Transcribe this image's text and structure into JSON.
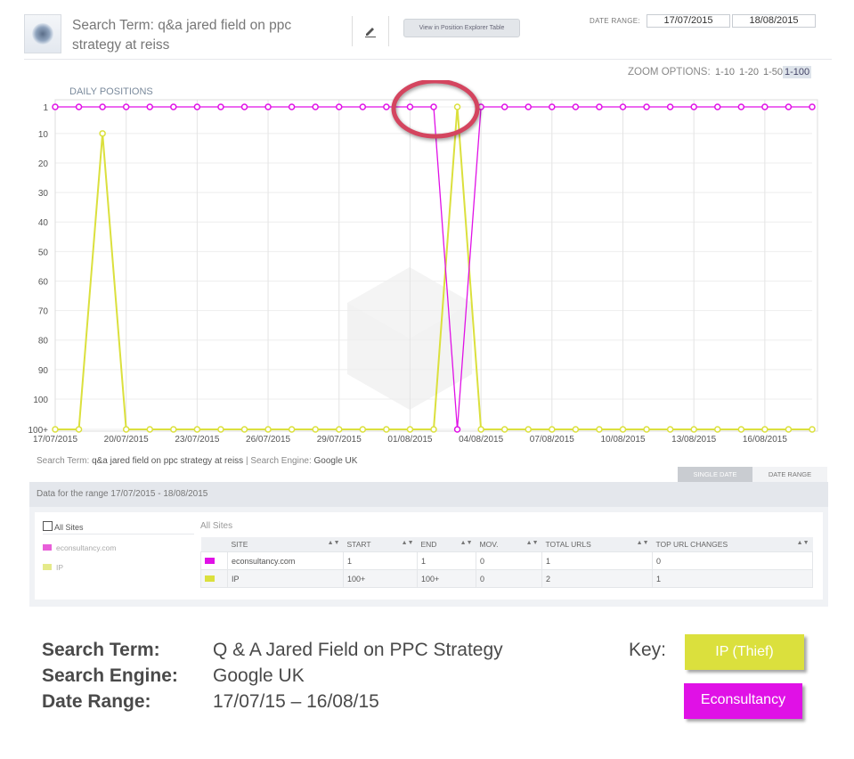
{
  "header": {
    "search_term_label": "Search Term: q&a jared field on ppc strategy at reiss",
    "view_button": "View in Position Explorer Table",
    "date_range_label": "DATE RANGE:",
    "date_from": "17/07/2015",
    "date_to": "18/08/2015",
    "thumbnail_icon": "brand-logo-icon",
    "edit_icon": "pencil-icon"
  },
  "zoom": {
    "label": "ZOOM OPTIONS:",
    "options": [
      "1-10",
      "1-20",
      "1-50",
      "1-100"
    ],
    "selected": "1-100"
  },
  "chart_data": {
    "type": "line",
    "title": "DAILY POSITIONS",
    "ylabel": "",
    "xlabel": "",
    "y_ticks": [
      "1",
      "10",
      "20",
      "30",
      "40",
      "50",
      "60",
      "70",
      "80",
      "90",
      "100",
      "100+"
    ],
    "y_tick_values": [
      1,
      10,
      20,
      30,
      40,
      50,
      60,
      70,
      80,
      90,
      100,
      101
    ],
    "y_inverted": true,
    "ylim": [
      1,
      101
    ],
    "x_tick_labels": [
      "17/07/2015",
      "20/07/2015",
      "23/07/2015",
      "26/07/2015",
      "29/07/2015",
      "01/08/2015",
      "04/08/2015",
      "07/08/2015",
      "10/08/2015",
      "13/08/2015",
      "16/08/2015"
    ],
    "x": [
      "17/07/2015",
      "18/07/2015",
      "19/07/2015",
      "20/07/2015",
      "21/07/2015",
      "22/07/2015",
      "23/07/2015",
      "24/07/2015",
      "25/07/2015",
      "26/07/2015",
      "27/07/2015",
      "28/07/2015",
      "29/07/2015",
      "30/07/2015",
      "31/07/2015",
      "01/08/2015",
      "02/08/2015",
      "03/08/2015",
      "04/08/2015",
      "05/08/2015",
      "06/08/2015",
      "07/08/2015",
      "08/08/2015",
      "09/08/2015",
      "10/08/2015",
      "11/08/2015",
      "12/08/2015",
      "13/08/2015",
      "14/08/2015",
      "15/08/2015",
      "16/08/2015",
      "17/08/2015",
      "18/08/2015"
    ],
    "series": [
      {
        "name": "econsultancy.com",
        "color": "#e011e6",
        "values": [
          1,
          1,
          1,
          1,
          1,
          1,
          1,
          1,
          1,
          1,
          1,
          1,
          1,
          1,
          1,
          1,
          1,
          "100+",
          1,
          1,
          1,
          1,
          1,
          1,
          1,
          1,
          1,
          1,
          1,
          1,
          1,
          1,
          1,
          1
        ]
      },
      {
        "name": "IP",
        "color": "#dbe03d",
        "values": [
          "100+",
          "100+",
          10,
          "100+",
          "100+",
          "100+",
          "100+",
          "100+",
          "100+",
          "100+",
          "100+",
          "100+",
          "100+",
          "100+",
          "100+",
          "100+",
          "100+",
          1,
          "100+",
          "100+",
          "100+",
          "100+",
          "100+",
          "100+",
          "100+",
          "100+",
          "100+",
          "100+",
          "100+",
          "100+",
          "100+",
          "100+",
          "100+",
          "100+"
        ]
      }
    ],
    "grid": true,
    "legend": "none",
    "highlight_color": "#d4455f"
  },
  "caption": {
    "search_term_prefix": "Search Term:",
    "search_term": "q&a jared field on ppc strategy at reiss",
    "separator": "|",
    "engine_prefix": "Search Engine:",
    "engine": "Google UK"
  },
  "panel": {
    "tab_single": "SINGLE DATE",
    "tab_range": "DATE RANGE",
    "range_text": "Data for the range 17/07/2015 - 18/08/2015",
    "all_sites_checkbox": "All Sites",
    "legend": [
      {
        "name": "econsultancy.com",
        "color": "#e85fd9"
      },
      {
        "name": "IP",
        "color": "#e5ea8a"
      }
    ],
    "all_sites_title": "All Sites",
    "columns": [
      "SITE",
      "START",
      "END",
      "MOV.",
      "TOTAL URLS",
      "TOP URL CHANGES"
    ],
    "rows": [
      {
        "color": "#e011e6",
        "site": "econsultancy.com",
        "start": "1",
        "end": "1",
        "mov": "0",
        "total_urls": "1",
        "top_url_changes": "0"
      },
      {
        "color": "#dbe03d",
        "site": "IP",
        "start": "100+",
        "end": "100+",
        "mov": "0",
        "total_urls": "2",
        "top_url_changes": "1"
      }
    ]
  },
  "summary": {
    "search_term_label": "Search Term:",
    "search_term_value": "Q & A Jared Field on PPC Strategy",
    "engine_label": "Search Engine:",
    "engine_value": "Google UK",
    "date_label": "Date Range:",
    "date_value": "17/07/15 – 16/08/15",
    "key_label": "Key:",
    "key_ip": "IP (Thief)",
    "key_econ": "Econsultancy"
  }
}
